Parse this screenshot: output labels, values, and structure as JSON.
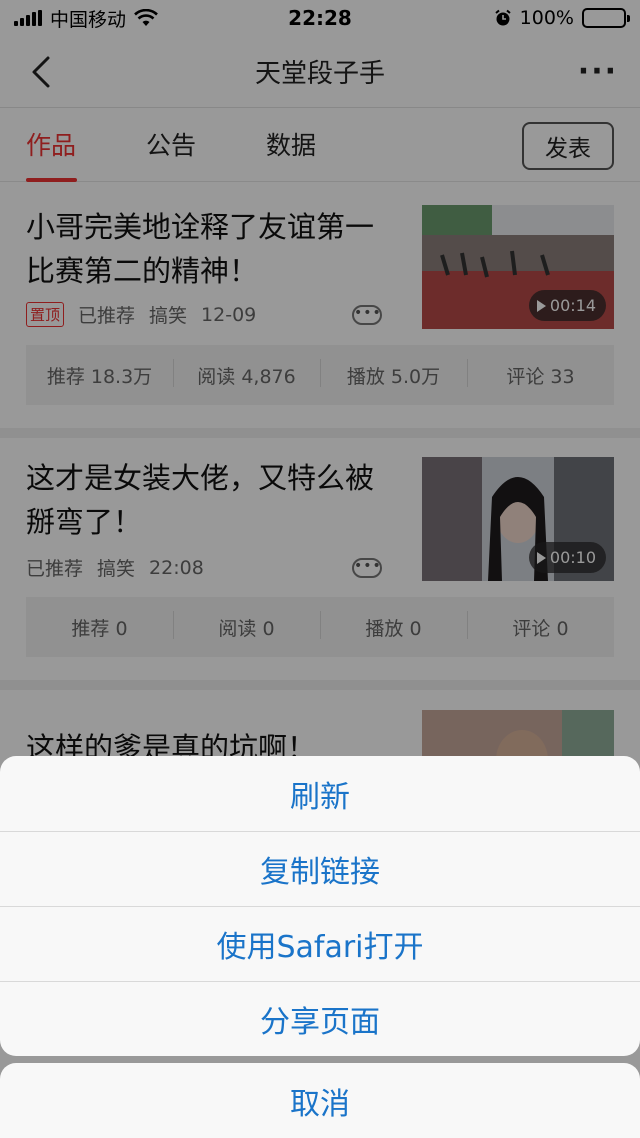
{
  "status_bar": {
    "carrier": "中国移动",
    "time": "22:28",
    "battery": "100%"
  },
  "nav": {
    "title": "天堂段子手"
  },
  "tabs": [
    {
      "label": "作品",
      "active": true
    },
    {
      "label": "公告",
      "active": false
    },
    {
      "label": "数据",
      "active": false
    }
  ],
  "publish_label": "发表",
  "articles": [
    {
      "title": "小哥完美地诠释了友谊第一比赛第二的精神！",
      "pinned_label": "置顶",
      "recommended": "已推荐",
      "category": "搞笑",
      "time": "12-09",
      "duration": "00:14",
      "stats": [
        "推荐 18.3万",
        "阅读 4,876",
        "播放 5.0万",
        "评论 33"
      ]
    },
    {
      "title": "这才是女装大佬，又特么被掰弯了！",
      "recommended": "已推荐",
      "category": "搞笑",
      "time": "22:08",
      "duration": "00:10",
      "stats": [
        "推荐 0",
        "阅读 0",
        "播放 0",
        "评论 0"
      ]
    },
    {
      "title": "这样的爹是真的坑啊！"
    }
  ],
  "action_sheet": {
    "items": [
      "刷新",
      "复制链接",
      "使用Safari打开",
      "分享页面"
    ],
    "cancel": "取消"
  },
  "colors": {
    "accent": "#e33333",
    "action": "#1a74c9"
  },
  "icons": [
    "signal-icon",
    "wifi-icon",
    "alarm-icon",
    "battery-icon",
    "back-arrow-icon",
    "more-icon",
    "play-icon"
  ]
}
